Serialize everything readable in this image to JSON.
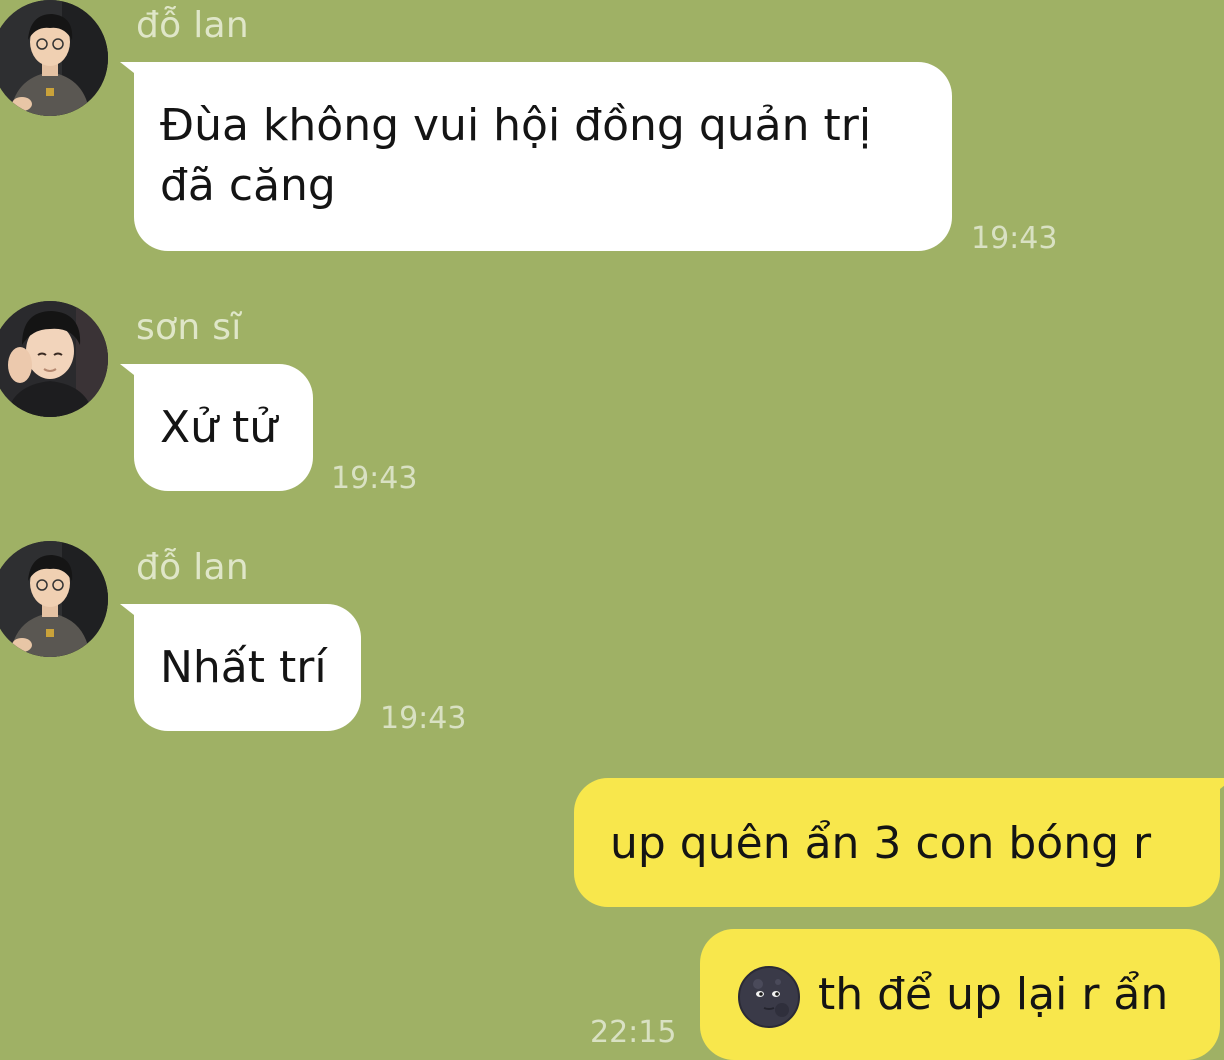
{
  "messages": [
    {
      "type": "incoming",
      "sender": "đỗ lan",
      "avatar": "avatar-do-lan",
      "lines": [
        "Đùa không vui hội đồng quản trị",
        "đã căng"
      ],
      "time": "19:43"
    },
    {
      "type": "incoming",
      "sender": "sơn sĩ",
      "avatar": "avatar-son-si",
      "lines": [
        "Xử tử"
      ],
      "time": "19:43"
    },
    {
      "type": "incoming",
      "sender": "đỗ lan",
      "avatar": "avatar-do-lan",
      "lines": [
        "Nhất trí"
      ],
      "time": "19:43"
    },
    {
      "type": "outgoing",
      "lines": [
        "up quên ẩn 3 con bóng r"
      ]
    },
    {
      "type": "outgoing",
      "emoji": "new-moon-face-emoji",
      "lines": [
        "th để up lại r ẩn"
      ],
      "time": "22:15"
    }
  ],
  "colors": {
    "chat_background": "#9fb165",
    "incoming_bubble": "#ffffff",
    "outgoing_bubble": "#f8e74c",
    "meta_text": "#dfe6c8"
  }
}
